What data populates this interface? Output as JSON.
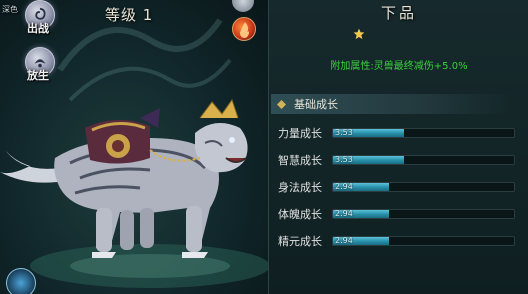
{
  "left": {
    "top_tag": "深色",
    "deploy_label": "出战",
    "release_label": "放生",
    "level_text": "等级 1"
  },
  "right": {
    "grade": "下品",
    "stars": 1,
    "bonus_text": "附加属性:灵兽最终减伤+5.0%",
    "section_title": "基础成长",
    "stats": [
      {
        "label": "力量成长",
        "value": "3.53",
        "fill": 0.39
      },
      {
        "label": "智慧成长",
        "value": "3.53",
        "fill": 0.39
      },
      {
        "label": "身法成长",
        "value": "2.94",
        "fill": 0.31
      },
      {
        "label": "体魄成长",
        "value": "2.94",
        "fill": 0.31
      },
      {
        "label": "精元成长",
        "value": "2.94",
        "fill": 0.31
      }
    ]
  },
  "colors": {
    "bonus": "#39d13d",
    "bar": "#2a93ae",
    "star": "#f1c84a"
  }
}
